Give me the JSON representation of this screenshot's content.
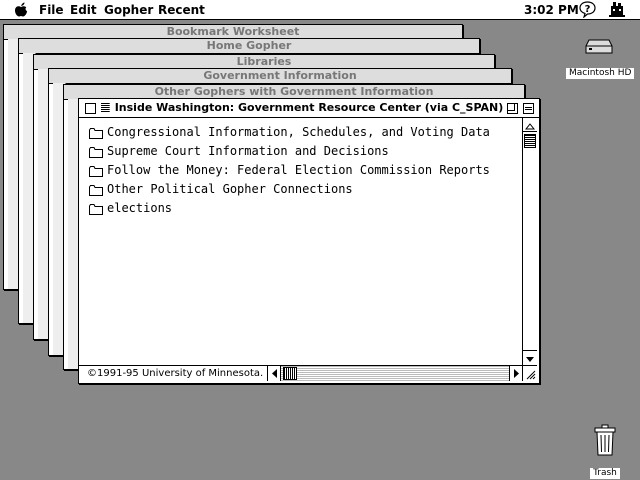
{
  "menubar": {
    "menus": [
      "File",
      "Edit",
      "Gopher",
      "Recent"
    ],
    "clock": "3:02 PM"
  },
  "desktop": {
    "hd_label": "Macintosh HD",
    "trash_label": "Trash"
  },
  "background_windows": [
    {
      "title": "Bookmark Worksheet"
    },
    {
      "title": "Home Gopher"
    },
    {
      "title": "Libraries"
    },
    {
      "title": "Government Information"
    },
    {
      "title": "Other Gophers with Government Information"
    }
  ],
  "front_window": {
    "title": "Inside Washington: Government Resource Center (via C_SPAN)",
    "items": [
      {
        "label": "Congressional Information, Schedules, and Voting Data"
      },
      {
        "label": "Supreme Court Information and Decisions"
      },
      {
        "label": "Follow the Money: Federal Election Commission Reports"
      },
      {
        "label": "Other Political Gopher Connections"
      },
      {
        "label": "elections"
      }
    ],
    "status": "©1991-95 University of Minnesota."
  }
}
